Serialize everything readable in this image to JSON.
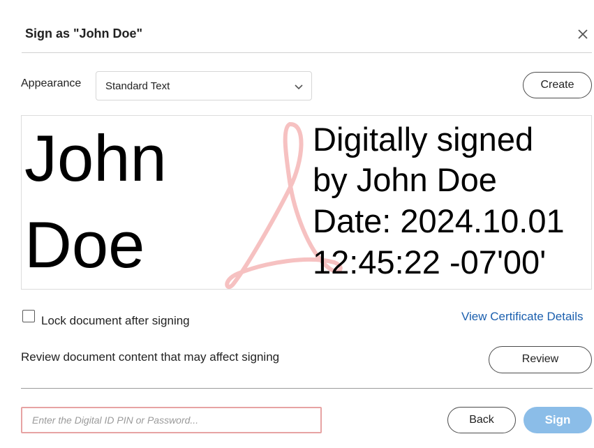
{
  "dialog": {
    "title": "Sign as \"John Doe\"",
    "close_icon": "close-icon"
  },
  "appearance": {
    "label": "Appearance",
    "selected": "Standard Text",
    "chevron_icon": "chevron-down-icon",
    "create_label": "Create"
  },
  "preview": {
    "name_line1": "John",
    "name_line2": "Doe",
    "details": [
      "Digitally signed",
      "by John Doe",
      "Date: 2024.10.01",
      "12:45:22 -07'00'"
    ],
    "watermark_icon": "acrobat-logo-watermark",
    "watermark_color": "#f4b6b6"
  },
  "options": {
    "lock_label": "Lock document after signing",
    "lock_checked": false,
    "certificate_link": "View Certificate Details"
  },
  "review": {
    "text": "Review document content that may affect signing",
    "button_label": "Review"
  },
  "footer": {
    "pin_placeholder": "Enter the Digital ID PIN or Password...",
    "pin_value": "",
    "back_label": "Back",
    "sign_label": "Sign",
    "sign_color": "#8bbde8",
    "link_color": "#1b5fae",
    "pin_border_color": "#e7a3a3"
  }
}
